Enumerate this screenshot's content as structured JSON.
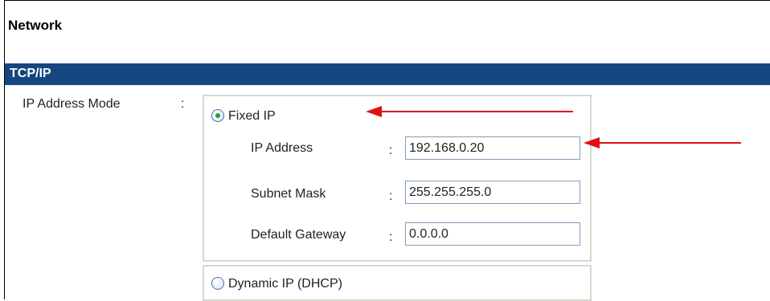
{
  "page": {
    "title": "Network"
  },
  "section": {
    "title": "TCP/IP"
  },
  "ip_mode": {
    "label": "IP Address Mode",
    "colon": ":",
    "selected": "fixed",
    "options": {
      "fixed": {
        "label": "Fixed IP",
        "checked": true
      },
      "dhcp": {
        "label": "Dynamic IP (DHCP)",
        "checked": false
      }
    }
  },
  "fixed_ip": {
    "colon": ":",
    "ip_address": {
      "label": "IP Address",
      "value": "192.168.0.20"
    },
    "subnet_mask": {
      "label": "Subnet Mask",
      "value": "255.255.255.0"
    },
    "default_gateway": {
      "label": "Default Gateway",
      "value": "0.0.0.0"
    }
  },
  "colors": {
    "section_bar": "#15467f",
    "arrow": "#e01010",
    "radio_dot": "#23a035",
    "group_border": "#d8d8d0",
    "input_border": "#7f9db9"
  }
}
